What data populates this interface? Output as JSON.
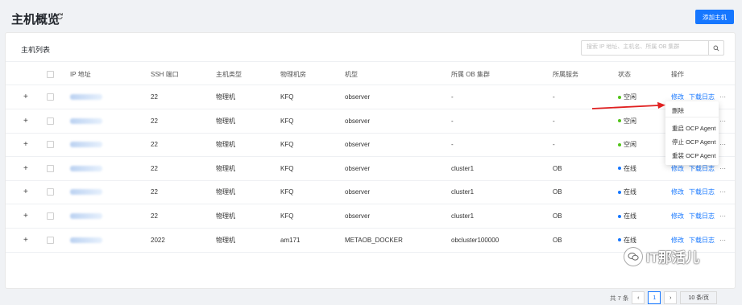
{
  "header": {
    "title": "主机概览",
    "add_button": "添加主机"
  },
  "list": {
    "title": "主机列表",
    "search_placeholder": "搜索 IP 地址、主机名、所属 OB 集群"
  },
  "columns": [
    "IP 地址",
    "SSH 端口",
    "主机类型",
    "物理机房",
    "机型",
    "所属 OB 集群",
    "所属服务",
    "状态",
    "操作"
  ],
  "rows": [
    {
      "port": "22",
      "type": "物理机",
      "room": "KFQ",
      "model": "observer",
      "cluster": "-",
      "service": "-",
      "status": "空闲",
      "status_color": "#52c41a"
    },
    {
      "port": "22",
      "type": "物理机",
      "room": "KFQ",
      "model": "observer",
      "cluster": "-",
      "service": "-",
      "status": "空闲",
      "status_color": "#52c41a"
    },
    {
      "port": "22",
      "type": "物理机",
      "room": "KFQ",
      "model": "observer",
      "cluster": "-",
      "service": "-",
      "status": "空闲",
      "status_color": "#52c41a"
    },
    {
      "port": "22",
      "type": "物理机",
      "room": "KFQ",
      "model": "observer",
      "cluster": "cluster1",
      "service": "OB",
      "status": "在线",
      "status_color": "#1677ff"
    },
    {
      "port": "22",
      "type": "物理机",
      "room": "KFQ",
      "model": "observer",
      "cluster": "cluster1",
      "service": "OB",
      "status": "在线",
      "status_color": "#1677ff"
    },
    {
      "port": "22",
      "type": "物理机",
      "room": "KFQ",
      "model": "observer",
      "cluster": "cluster1",
      "service": "OB",
      "status": "在线",
      "status_color": "#1677ff"
    },
    {
      "port": "2022",
      "type": "物理机",
      "room": "am171",
      "model": "METAOB_DOCKER",
      "cluster": "obcluster100000",
      "service": "OB",
      "status": "在线",
      "status_color": "#1677ff"
    }
  ],
  "actions": {
    "edit": "修改",
    "download": "下载日志",
    "more": "···"
  },
  "dropdown": {
    "items": [
      "删除",
      "重启 OCP Agent",
      "停止 OCP Agent",
      "重装 OCP Agent"
    ]
  },
  "pagination": {
    "total": "共 7 条",
    "current": "1",
    "page_size": "10 条/页"
  },
  "watermark": {
    "text": "IT那活儿"
  },
  "colors": {
    "primary": "#1677ff",
    "annotation_arrow": "#e02020"
  }
}
